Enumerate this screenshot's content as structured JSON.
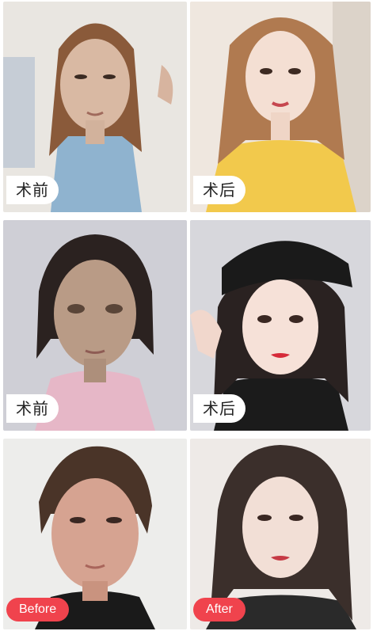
{
  "panels": [
    {
      "id": "p1",
      "label": "术前",
      "style": "cn",
      "side": "before",
      "colors": {
        "bg": "#e9e6e1",
        "hair": "#8a5a3a",
        "skin": "#d9b9a3",
        "cloth": "#8fb3cf"
      }
    },
    {
      "id": "p2",
      "label": "术后",
      "style": "cn",
      "side": "after",
      "colors": {
        "bg": "#efe7df",
        "hair": "#b07a50",
        "skin": "#f4dfd3",
        "cloth": "#f2c94c"
      }
    },
    {
      "id": "p3",
      "label": "术前",
      "style": "cn",
      "side": "before",
      "colors": {
        "bg": "#cfcfd6",
        "hair": "#2b2220",
        "skin": "#b99b86",
        "cloth": "#e6b7c7"
      }
    },
    {
      "id": "p4",
      "label": "术后",
      "style": "cn",
      "side": "after",
      "colors": {
        "bg": "#d7d7dc",
        "hair": "#2a2221",
        "skin": "#f6e1d8",
        "cloth": "#1b1b1b",
        "hat": "#1a1a1a"
      }
    },
    {
      "id": "p5",
      "label": "Before",
      "style": "en",
      "side": "before",
      "colors": {
        "bg": "#ededeb",
        "hair": "#4a3428",
        "skin": "#d6a391",
        "cloth": "#1a1a1a"
      }
    },
    {
      "id": "p6",
      "label": "After",
      "style": "en",
      "side": "after",
      "colors": {
        "bg": "#eeeae7",
        "hair": "#3b2f2b",
        "skin": "#f2dfd6",
        "cloth": "#2a2a2a"
      }
    }
  ]
}
